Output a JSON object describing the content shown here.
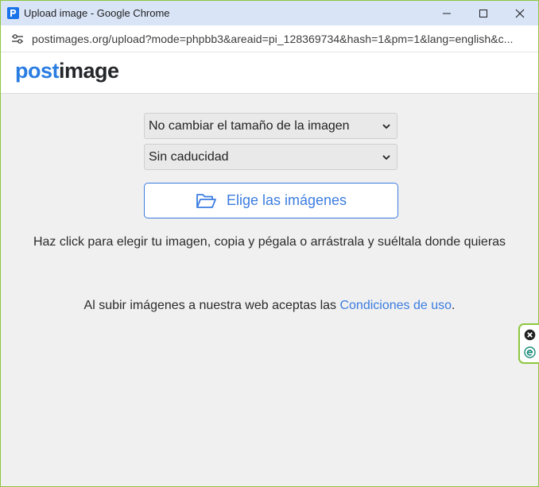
{
  "window": {
    "title": "Upload image - Google Chrome",
    "url": "postimages.org/upload?mode=phpbb3&areaid=pi_128369734&hash=1&pm=1&lang=english&c..."
  },
  "header": {
    "logo_part1": "post",
    "logo_part2": "image"
  },
  "form": {
    "resize_select": "No cambiar el tamaño de la imagen",
    "expiry_select": "Sin caducidad",
    "choose_button": "Elige las imágenes",
    "instructions": "Haz click para elegir tu imagen, copia y pégala o arrástrala y suéltala donde quieras",
    "terms_prefix": "Al subir imágenes a nuestra web aceptas las ",
    "terms_link": "Condiciones de uso",
    "terms_suffix": "."
  },
  "colors": {
    "accent": "#3b7ce0",
    "frame_border": "#8dc63f",
    "page_bg": "#f0f0f0"
  }
}
